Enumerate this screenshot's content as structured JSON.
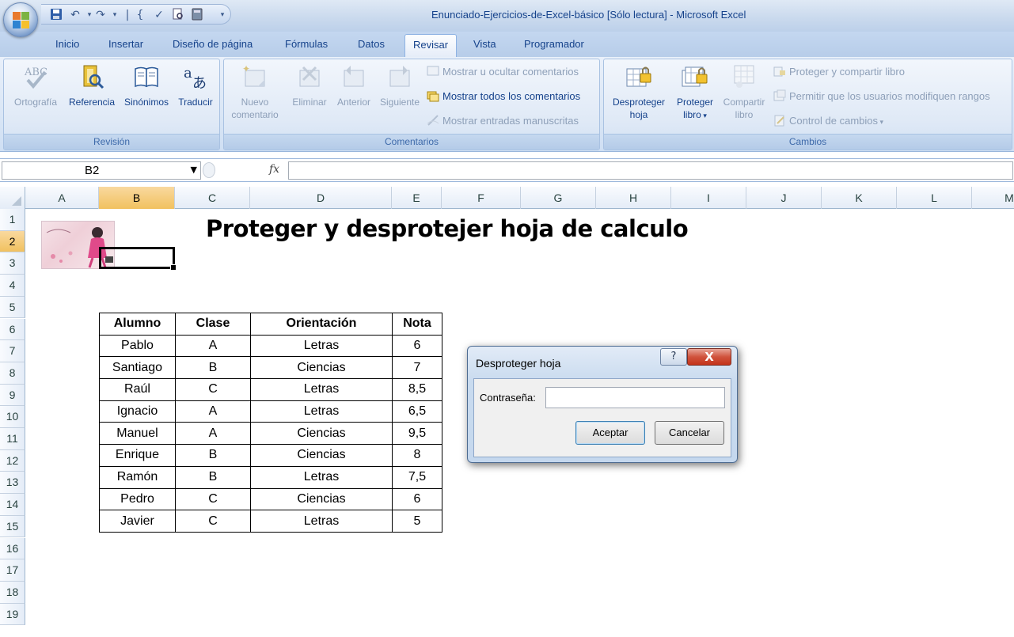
{
  "window": {
    "title": "Enunciado-Ejercicios-de-Excel-básico  [Sólo lectura] - Microsoft Excel"
  },
  "tabs": [
    {
      "label": "Inicio"
    },
    {
      "label": "Insertar"
    },
    {
      "label": "Diseño de página"
    },
    {
      "label": "Fórmulas"
    },
    {
      "label": "Datos"
    },
    {
      "label": "Revisar",
      "active": true
    },
    {
      "label": "Vista"
    },
    {
      "label": "Programador"
    }
  ],
  "ribbon": {
    "revision": {
      "label": "Revisión",
      "ortografia": "Ortografía",
      "referencia": "Referencia",
      "sinonimos": "Sinónimos",
      "traducir": "Traducir"
    },
    "comentarios": {
      "label": "Comentarios",
      "nuevo_1": "Nuevo",
      "nuevo_2": "comentario",
      "eliminar": "Eliminar",
      "anterior": "Anterior",
      "siguiente": "Siguiente",
      "mostrar_ocultar": "Mostrar u ocultar comentarios",
      "mostrar_todos": "Mostrar todos los comentarios",
      "mostrar_entradas": "Mostrar entradas manuscritas"
    },
    "cambios": {
      "label": "Cambios",
      "desproteger_1": "Desproteger",
      "desproteger_2": "hoja",
      "proteger_1": "Proteger",
      "proteger_2": "libro",
      "compartir_1": "Compartir",
      "compartir_2": "libro",
      "proteger_compartir": "Proteger y compartir libro",
      "permitir": "Permitir que los usuarios modifiquen rangos",
      "control": "Control de cambios"
    }
  },
  "formula_bar": {
    "name_box": "B2",
    "fx": "fx",
    "value": ""
  },
  "columns": [
    {
      "label": "A",
      "w": 93
    },
    {
      "label": "B",
      "w": 96,
      "selected": true
    },
    {
      "label": "C",
      "w": 95
    },
    {
      "label": "D",
      "w": 179
    },
    {
      "label": "E",
      "w": 63
    },
    {
      "label": "F",
      "w": 100
    },
    {
      "label": "G",
      "w": 95
    },
    {
      "label": "H",
      "w": 95
    },
    {
      "label": "I",
      "w": 95
    },
    {
      "label": "J",
      "w": 95
    },
    {
      "label": "K",
      "w": 95
    },
    {
      "label": "L",
      "w": 95
    },
    {
      "label": "M",
      "w": 95
    }
  ],
  "rows": [
    "1",
    "2",
    "3",
    "4",
    "5",
    "6",
    "7",
    "8",
    "9",
    "10",
    "11",
    "12",
    "13",
    "14",
    "15",
    "16",
    "17",
    "18",
    "19"
  ],
  "sheet": {
    "title": "Proteger y desprotejer hoja de calculo"
  },
  "table": {
    "headers": [
      "Alumno",
      "Clase",
      "Orientación",
      "Nota"
    ],
    "rows": [
      [
        "Pablo",
        "A",
        "Letras",
        "6"
      ],
      [
        "Santiago",
        "B",
        "Ciencias",
        "7"
      ],
      [
        "Raúl",
        "C",
        "Letras",
        "8,5"
      ],
      [
        "Ignacio",
        "A",
        "Letras",
        "6,5"
      ],
      [
        "Manuel",
        "A",
        "Ciencias",
        "9,5"
      ],
      [
        "Enrique",
        "B",
        "Ciencias",
        "8"
      ],
      [
        "Ramón",
        "B",
        "Letras",
        "7,5"
      ],
      [
        "Pedro",
        "C",
        "Ciencias",
        "6"
      ],
      [
        "Javier",
        "C",
        "Letras",
        "5"
      ]
    ]
  },
  "dialog": {
    "title": "Desproteger hoja",
    "help": "?",
    "close": "X",
    "password_label": "Contraseña:",
    "password_value": "",
    "ok": "Aceptar",
    "cancel": "Cancelar"
  },
  "colors": {
    "accent": "#15428b",
    "selected_header": "#f1c15f",
    "close_button": "#c4331a"
  }
}
